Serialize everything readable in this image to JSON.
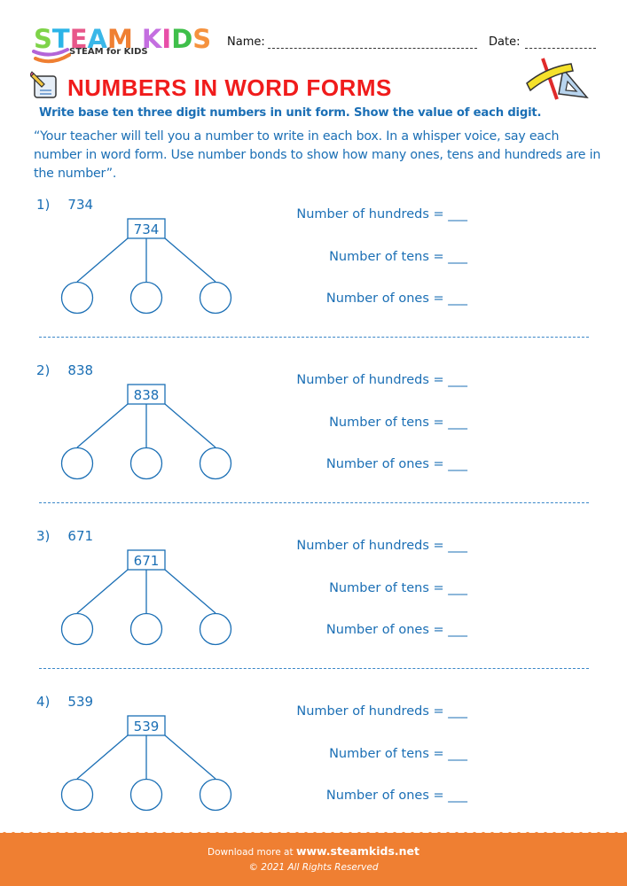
{
  "header": {
    "logo_letters": [
      {
        "ch": "S",
        "color": "#7ed348"
      },
      {
        "ch": "T",
        "color": "#2bb4e8"
      },
      {
        "ch": "E",
        "color": "#e8578a"
      },
      {
        "ch": "A",
        "color": "#3ab7e8"
      },
      {
        "ch": "M",
        "color": "#ef7f32"
      },
      {
        "ch": " ",
        "color": "#ffffff"
      },
      {
        "ch": "K",
        "color": "#c46ee0"
      },
      {
        "ch": "I",
        "color": "#e84ea8"
      },
      {
        "ch": "D",
        "color": "#3fbf4a"
      },
      {
        "ch": "S",
        "color": "#f5923e"
      }
    ],
    "logo_subtitle": "STEAM for KIDS",
    "name_label": "Name:",
    "date_label": "Date:"
  },
  "title": "NUMBERS IN WORD FORMS",
  "instruction": "Write base ten three digit numbers in unit form. Show the value of each digit.",
  "quote": "“Your teacher will tell you a number to write in each box. In a whisper voice, say each number in word form. Use number bonds to show how many ones, tens and hundreds are in the number”.",
  "questions": [
    {
      "label": "1)",
      "number": "734",
      "hundreds": "Number of hundreds = ___",
      "tens": "Number of tens = ___",
      "ones": "Number of ones = ___"
    },
    {
      "label": "2)",
      "number": "838",
      "hundreds": "Number of hundreds = ___",
      "tens": "Number of tens = ___",
      "ones": "Number of ones = ___"
    },
    {
      "label": "3)",
      "number": "671",
      "hundreds": "Number of hundreds = ___",
      "tens": "Number of tens = ___",
      "ones": "Number of ones = ___"
    },
    {
      "label": "4)",
      "number": "539",
      "hundreds": "Number of hundreds = ___",
      "tens": "Number of tens = ___",
      "ones": "Number of ones = ___"
    }
  ],
  "footer": {
    "download_prefix": "Download more at",
    "download_link": "www.steamkids.net",
    "copyright": "© 2021 All Rights Reserved"
  },
  "colors": {
    "title": "#f01c1c",
    "text_blue": "#1b6fb5",
    "footer_orange": "#ef7f32"
  }
}
